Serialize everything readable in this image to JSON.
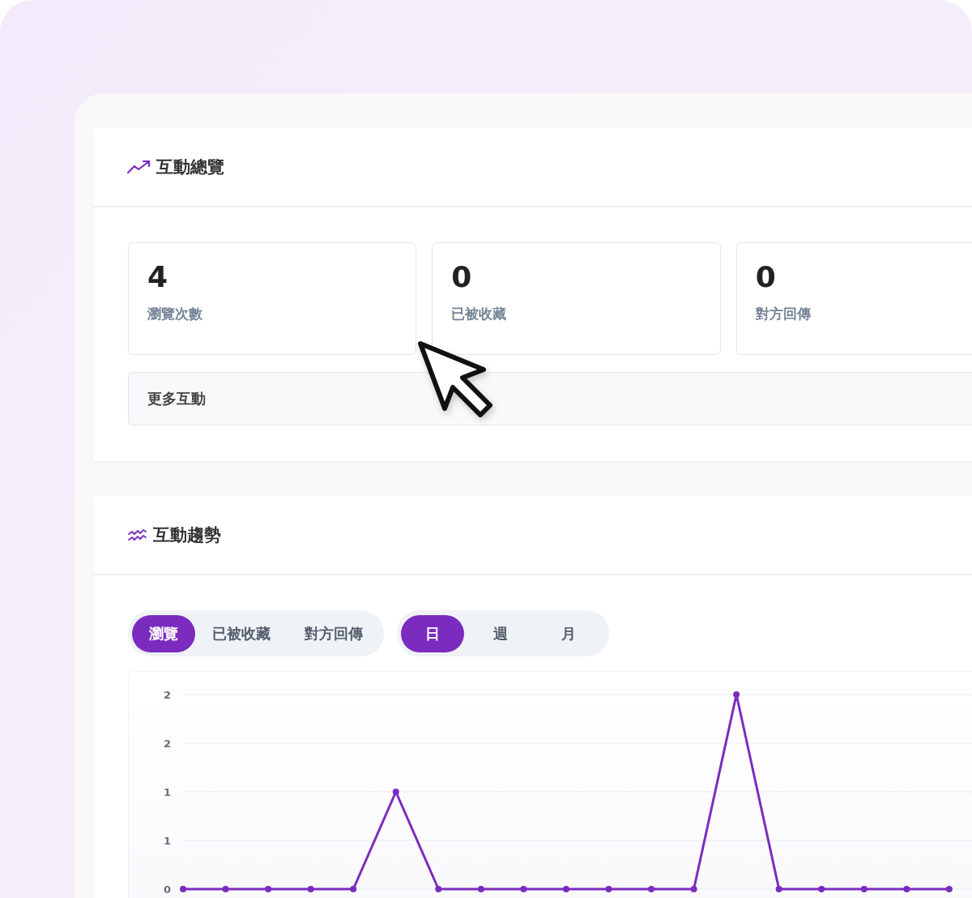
{
  "overview": {
    "title": "互動總覽",
    "stats": [
      {
        "value": "4",
        "label": "瀏覽次數"
      },
      {
        "value": "0",
        "label": "已被收藏"
      },
      {
        "value": "0",
        "label": "對方回傳"
      }
    ],
    "more_button": "更多互動"
  },
  "trend": {
    "title": "互動趨勢",
    "metric_tabs": [
      {
        "label": "瀏覽",
        "selected": true
      },
      {
        "label": "已被收藏",
        "selected": false
      },
      {
        "label": "對方回傳",
        "selected": false
      }
    ],
    "period_tabs": [
      {
        "label": "日",
        "selected": true
      },
      {
        "label": "週",
        "selected": false
      },
      {
        "label": "月",
        "selected": false
      }
    ],
    "chart_data": {
      "type": "line",
      "grid": true,
      "ylim": [
        0,
        2
      ],
      "yticks": [
        {
          "value": 0,
          "label": "0"
        },
        {
          "value": 0.5,
          "label": "1"
        },
        {
          "value": 1,
          "label": "1"
        },
        {
          "value": 1.5,
          "label": "2"
        },
        {
          "value": 2,
          "label": "2"
        }
      ],
      "series": [
        {
          "color": "#7b2cbf",
          "marker": true,
          "values": [
            0,
            0,
            0,
            0,
            0,
            1,
            0,
            0,
            0,
            0,
            0,
            0,
            0,
            2,
            0,
            0,
            0,
            0,
            0
          ]
        }
      ]
    }
  }
}
